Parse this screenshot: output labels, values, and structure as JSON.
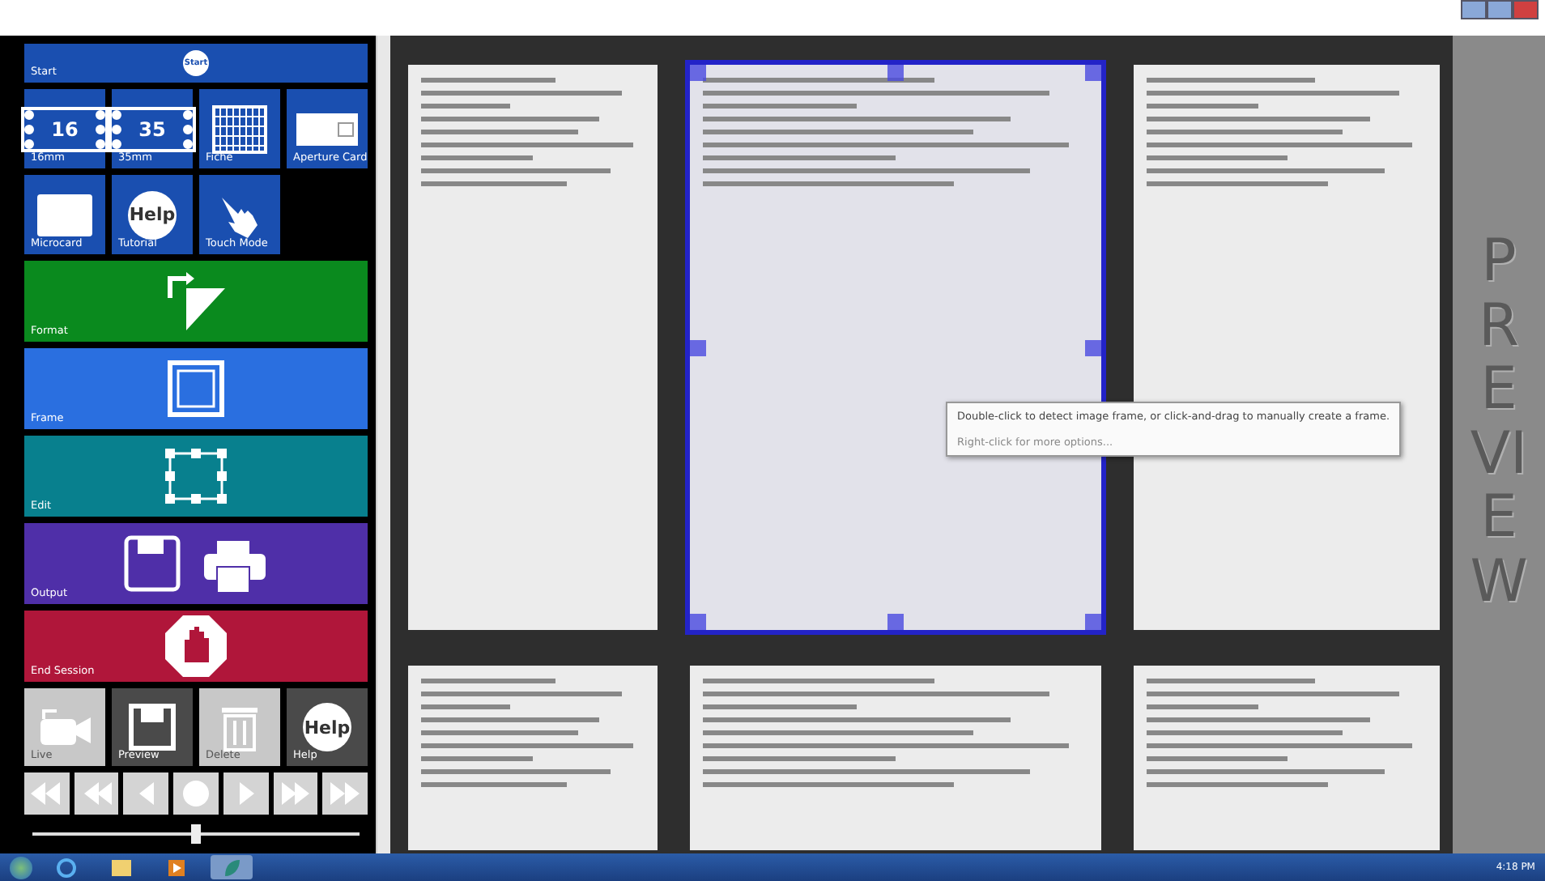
{
  "start_tile": {
    "label": "Start",
    "badge": "Start"
  },
  "media_tiles": [
    {
      "kind": "film",
      "label": "16mm",
      "number": "16"
    },
    {
      "kind": "film",
      "label": "35mm",
      "number": "35"
    },
    {
      "kind": "fiche",
      "label": "Fiche"
    },
    {
      "kind": "aperture",
      "label": "Aperture Card"
    },
    {
      "kind": "microcard",
      "label": "Microcard"
    },
    {
      "kind": "help",
      "label": "Tutorial",
      "badge": "Help"
    },
    {
      "kind": "touch",
      "label": "Touch Mode"
    }
  ],
  "mode_tiles": [
    {
      "kind": "format",
      "label": "Format",
      "color": "#0a8a1e"
    },
    {
      "kind": "frame",
      "label": "Frame",
      "color": "#2a6fe0"
    },
    {
      "kind": "edit",
      "label": "Edit",
      "color": "#08808e"
    },
    {
      "kind": "output",
      "label": "Output",
      "color": "#4f2fa8"
    },
    {
      "kind": "end",
      "label": "End Session",
      "color": "#b0163a"
    }
  ],
  "action_buttons": [
    {
      "kind": "camera",
      "label": "Live",
      "disabled": true
    },
    {
      "kind": "save",
      "label": "Preview",
      "disabled": false
    },
    {
      "kind": "trash",
      "label": "Delete",
      "disabled": true
    },
    {
      "kind": "help",
      "label": "Help",
      "badge": "Help",
      "disabled": false
    }
  ],
  "playback_buttons": [
    {
      "kind": "first"
    },
    {
      "kind": "rewind"
    },
    {
      "kind": "back"
    },
    {
      "kind": "stop"
    },
    {
      "kind": "play"
    },
    {
      "kind": "forward"
    },
    {
      "kind": "last"
    }
  ],
  "position_slider": {
    "level": 0.5
  },
  "viewer": {
    "pages": [
      {
        "selected": false
      },
      {
        "selected": true
      },
      {
        "selected": false
      },
      {
        "selected": false
      },
      {
        "selected": false
      },
      {
        "selected": false
      }
    ],
    "tooltip": {
      "line_1": "Double-click to detect image frame, or click-and-drag to manually create a frame.",
      "line_2": "Right-click for more options..."
    }
  },
  "preview_label": "PREVIEW",
  "taskbar": {
    "apps": [
      {
        "kind": "ie",
        "selected": false
      },
      {
        "kind": "folder",
        "selected": false
      },
      {
        "kind": "media",
        "selected": false
      },
      {
        "kind": "app",
        "selected": true
      }
    ],
    "clock": "4:18 PM"
  }
}
